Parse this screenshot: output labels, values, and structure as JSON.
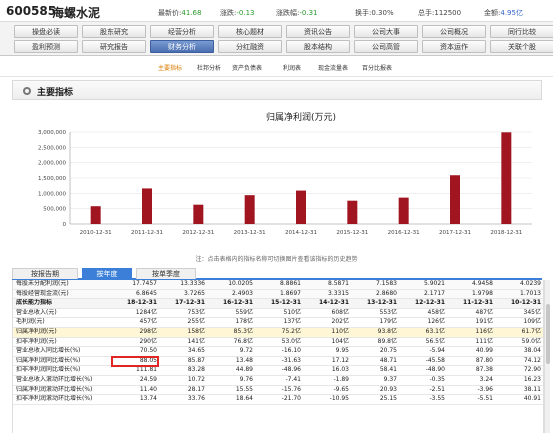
{
  "header": {
    "code": "600585",
    "name": "海螺水泥",
    "quotes": [
      {
        "label": "最新价:",
        "value": "41.68",
        "cls": "green"
      },
      {
        "label": "涨跌:",
        "value": "-0.13",
        "cls": "green"
      },
      {
        "label": "涨跌幅:",
        "value": "-0.31",
        "cls": "green"
      },
      {
        "label": "换手:",
        "value": "0.30%",
        "cls": ""
      },
      {
        "label": "总手:",
        "value": "112500",
        "cls": ""
      },
      {
        "label": "金额:",
        "value": "4.95亿",
        "cls": "blue"
      }
    ]
  },
  "nav": {
    "row1": [
      "操盘必读",
      "股东研究",
      "经营分析",
      "核心题材",
      "资讯公告",
      "公司大事",
      "公司概况",
      "同行比较"
    ],
    "row2": [
      "盈利预测",
      "研究报告",
      "财务分析",
      "分红融资",
      "股本结构",
      "公司高管",
      "资本运作",
      "关联个股"
    ],
    "active": "财务分析"
  },
  "subnav": {
    "items": [
      "主要指标",
      "杜邦分析",
      "资产负债表",
      "利润表",
      "现金流量表",
      "百分比报表"
    ],
    "active": "主要指标"
  },
  "section": {
    "title": "主要指标"
  },
  "chart_data": {
    "type": "bar",
    "title": "归属净利润(万元)",
    "categories": [
      "2010-12-31",
      "2011-12-31",
      "2012-12-31",
      "2013-12-31",
      "2014-12-31",
      "2015-12-31",
      "2016-12-31",
      "2017-12-31",
      "2018-12-31"
    ],
    "values": [
      580000,
      1160000,
      630000,
      940000,
      1090000,
      760000,
      860000,
      1590000,
      2990000
    ],
    "ylim": [
      0,
      3000000
    ],
    "yticks": [
      "0",
      "500,000",
      "1,000,000",
      "1,500,000",
      "2,000,000",
      "2,500,000",
      "3,000,000"
    ],
    "bar_color": "#a01520",
    "grid": true
  },
  "note": "注：点击表格内的指标名称可切换图片查看该指标的历史趋势",
  "tabs": {
    "items": [
      "按报告期",
      "按年度",
      "按单季度"
    ],
    "active": "按年度"
  },
  "table": {
    "header": [
      "成长能力指标",
      "18-12-31",
      "17-12-31",
      "16-12-31",
      "15-12-31",
      "14-12-31",
      "13-12-31",
      "12-12-31",
      "11-12-31",
      "10-12-31"
    ],
    "pre_rows": [
      {
        "label": "每股未分配利润(元)",
        "values": [
          "17.7457",
          "13.3336",
          "10.0205",
          "8.8861",
          "8.5871",
          "7.1583",
          "5.9021",
          "4.9458",
          "4.0239"
        ]
      },
      {
        "label": "每股经营现金流(元)",
        "values": [
          "6.8645",
          "3.7265",
          "2.4903",
          "1.8697",
          "3.3315",
          "2.8680",
          "2.1717",
          "1.9798",
          "1.7013"
        ]
      }
    ],
    "rows": [
      {
        "label": "营业总收入(元)",
        "values": [
          "1284亿",
          "753亿",
          "559亿",
          "510亿",
          "608亿",
          "553亿",
          "458亿",
          "487亿",
          "345亿"
        ]
      },
      {
        "label": "毛利润(元)",
        "values": [
          "457亿",
          "255亿",
          "178亿",
          "137亿",
          "202亿",
          "179亿",
          "126亿",
          "191亿",
          "109亿"
        ]
      },
      {
        "label": "归属净利润(元)",
        "values": [
          "298亿",
          "158亿",
          "85.3亿",
          "75.2亿",
          "110亿",
          "93.8亿",
          "63.1亿",
          "116亿",
          "61.7亿"
        ],
        "hl": true
      },
      {
        "label": "扣非净利润(元)",
        "values": [
          "290亿",
          "141亿",
          "76.8亿",
          "53.0亿",
          "104亿",
          "89.8亿",
          "56.5亿",
          "111亿",
          "59.0亿"
        ]
      },
      {
        "label": "营业总收入同比增长(%)",
        "values": [
          "70.50",
          "34.65",
          "9.72",
          "-16.10",
          "9.95",
          "20.75",
          "-5.94",
          "40.99",
          "38.04"
        ]
      },
      {
        "label": "归属净利润同比增长(%)",
        "values": [
          "88.05",
          "85.87",
          "13.48",
          "-31.63",
          "17.12",
          "48.71",
          "-45.58",
          "87.80",
          "74.12"
        ]
      },
      {
        "label": "扣非净利润同比增长(%)",
        "values": [
          "111.81",
          "83.28",
          "44.89",
          "-48.96",
          "16.03",
          "58.41",
          "-48.90",
          "87.38",
          "72.90"
        ]
      },
      {
        "label": "营业总收入滚动环比增长(%)",
        "values": [
          "24.59",
          "10.72",
          "9.76",
          "-7.41",
          "-1.89",
          "9.37",
          "-0.35",
          "3.24",
          "16.23"
        ]
      },
      {
        "label": "归属净利润滚动环比增长(%)",
        "values": [
          "11.40",
          "28.17",
          "15.55",
          "-15.76",
          "-9.65",
          "20.93",
          "-2.51",
          "-3.96",
          "38.11"
        ]
      },
      {
        "label": "扣非净利润滚动环比增长(%)",
        "values": [
          "13.74",
          "33.76",
          "18.64",
          "-21.70",
          "-10.95",
          "25.15",
          "-3.55",
          "-5.51",
          "40.91"
        ]
      }
    ]
  }
}
